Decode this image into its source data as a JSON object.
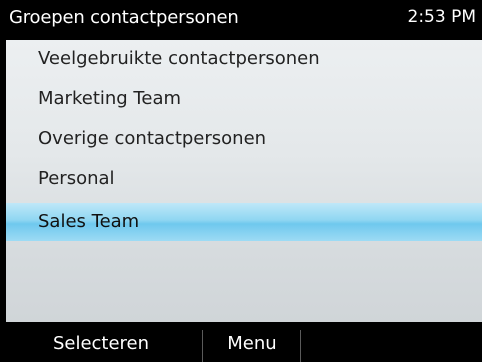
{
  "titlebar": {
    "title": "Groepen contactpersonen",
    "time": "2:53 PM"
  },
  "list": {
    "items": [
      {
        "label": "Veelgebruikte contactpersonen",
        "selected": false
      },
      {
        "label": "Marketing Team",
        "selected": false
      },
      {
        "label": "Overige contactpersonen",
        "selected": false
      },
      {
        "label": "Personal",
        "selected": false
      },
      {
        "label": "Sales Team",
        "selected": true
      }
    ]
  },
  "softkeys": {
    "left_label": "Selecteren",
    "right_label": "Menu"
  },
  "colors": {
    "selection": "#8fd6f2",
    "list_background": "#e4e8ea",
    "bars": "#000000"
  }
}
